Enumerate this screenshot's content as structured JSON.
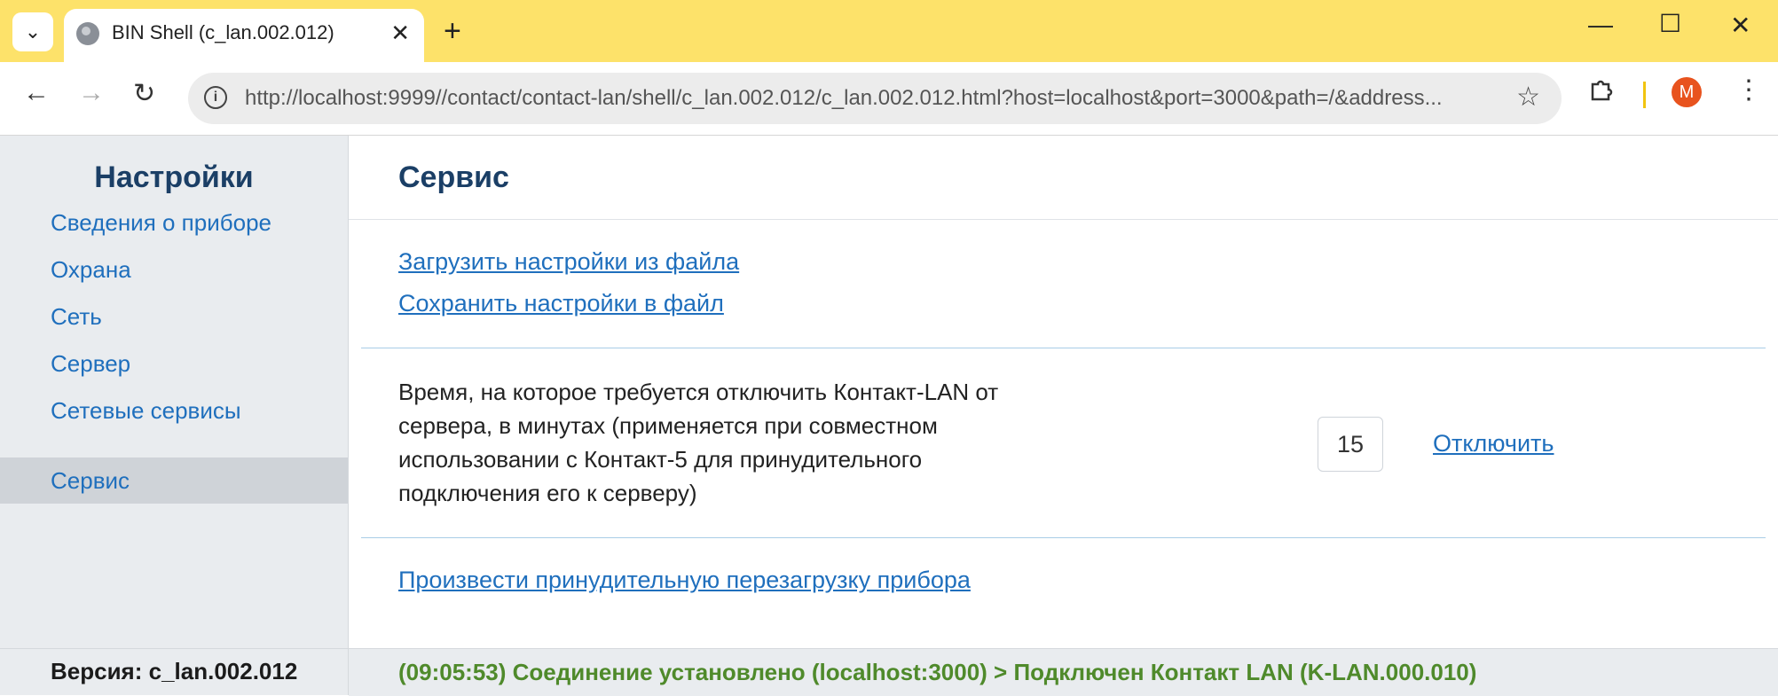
{
  "browser": {
    "tab_title": "BIN Shell (c_lan.002.012)",
    "url": "http://localhost:9999//contact/contact-lan/shell/c_lan.002.012/c_lan.002.012.html?host=localhost&port=3000&path=/&address...",
    "avatar_letter": "M"
  },
  "sidebar": {
    "title": "Настройки",
    "items": [
      {
        "label": "Сведения о приборе"
      },
      {
        "label": "Охрана"
      },
      {
        "label": "Сеть"
      },
      {
        "label": "Сервер"
      },
      {
        "label": "Сетевые сервисы"
      },
      {
        "label": "Сервис",
        "active": true
      }
    ],
    "version": "Версия: c_lan.002.012"
  },
  "main": {
    "title": "Сервис",
    "load_link": "Загрузить настройки из файла",
    "save_link": "Сохранить настройки в файл",
    "disconnect_description": "Время, на которое требуется отключить Контакт-LAN от сервера, в минутах (применяется при совместном использовании с Контакт-5 для принудительного подключения его к серверу)",
    "minutes_value": "15",
    "disconnect_link": "Отключить",
    "reboot_link": "Произвести принудительную перезагрузку прибора"
  },
  "status": {
    "text": "(09:05:53) Соединение установлено (localhost:3000) > Подключен Контакт LAN (K-LAN.000.010)"
  },
  "colors": {
    "tabbar": "#fde26a",
    "accent_link": "#1f6fbd",
    "heading": "#1b3f66",
    "status_ok": "#4f8a2b",
    "avatar": "#e8531e"
  }
}
